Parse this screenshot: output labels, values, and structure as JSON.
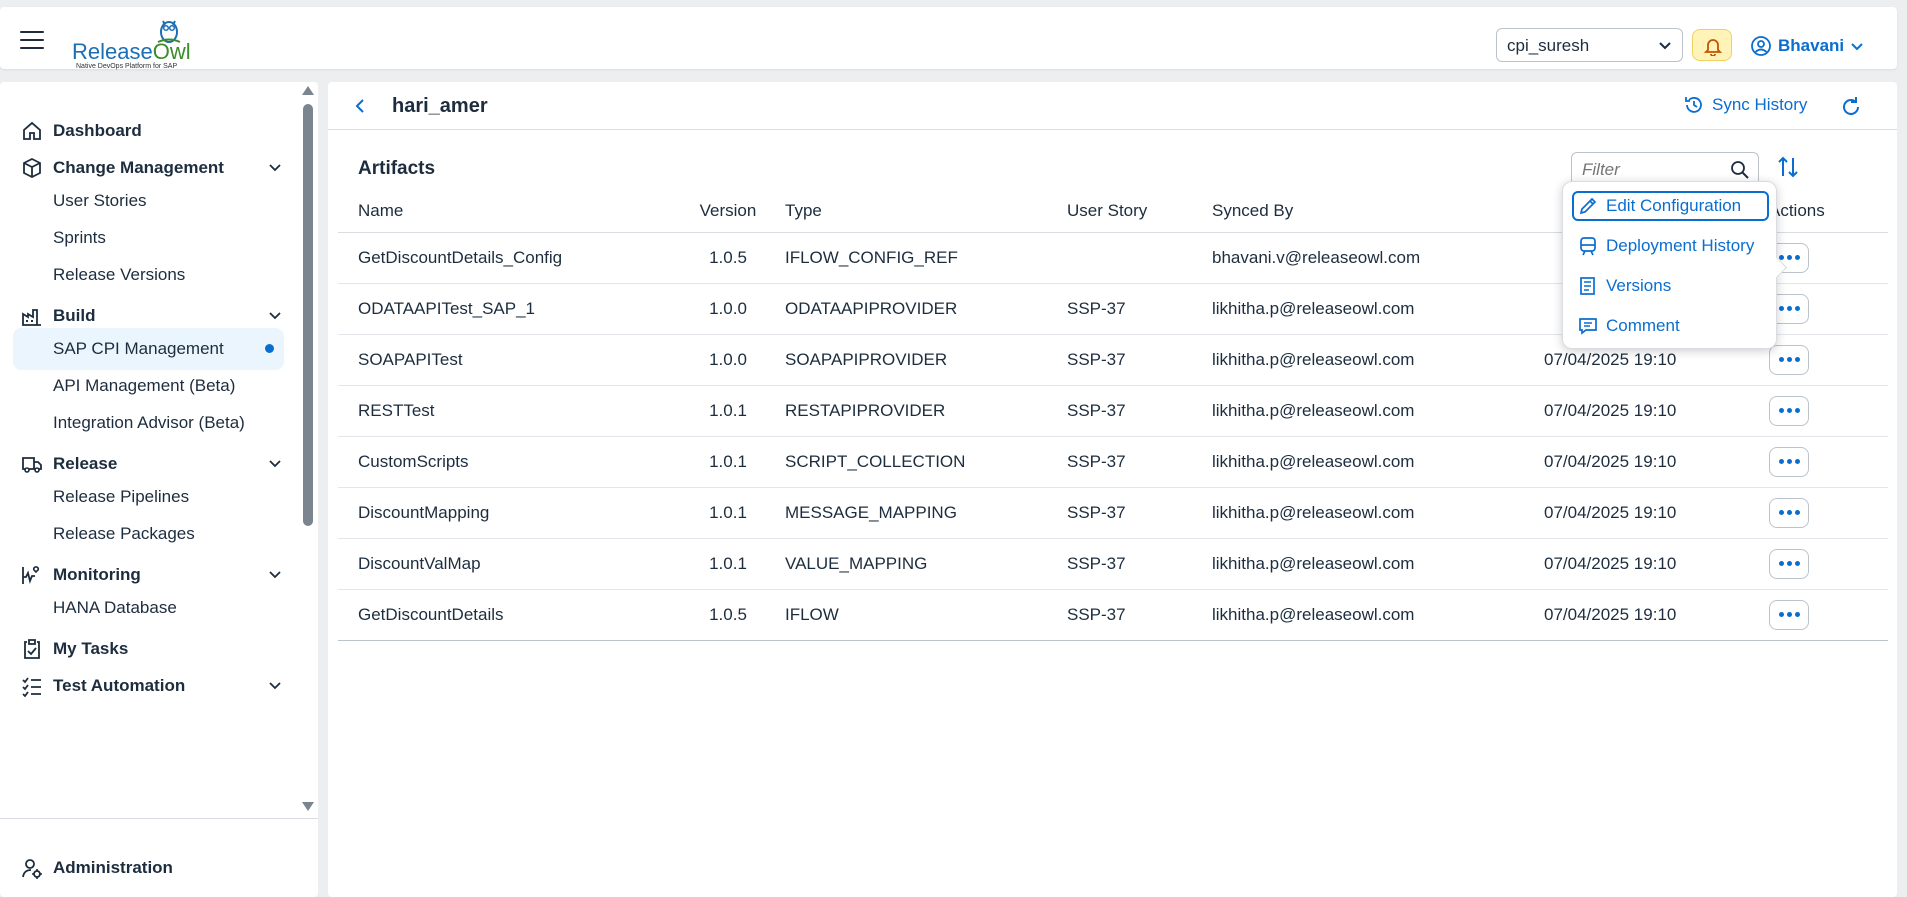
{
  "header": {
    "logo_release": "Release",
    "logo_owl": "Owl",
    "logo_tagline": "Native DevOps Platform for SAP",
    "tenant": "cpi_suresh",
    "user": "Bhavani"
  },
  "sidebar": {
    "groups": [
      {
        "label": "Dashboard",
        "icon": "home-icon"
      },
      {
        "label": "Change Management",
        "icon": "cube-icon"
      },
      {
        "label": "Build",
        "icon": "factory-icon"
      },
      {
        "label": "Release",
        "icon": "truck-icon"
      },
      {
        "label": "Monitoring",
        "icon": "heart-pulse-icon"
      },
      {
        "label": "My Tasks",
        "icon": "clipboard-icon"
      },
      {
        "label": "Test Automation",
        "icon": "checklist-icon"
      }
    ],
    "items": [
      "User Stories",
      "Sprints",
      "Release Versions",
      "SAP CPI Management",
      "API Management (Beta)",
      "Integration Advisor (Beta)",
      "Release Pipelines",
      "Release Packages",
      "HANA Database"
    ],
    "admin": "Administration"
  },
  "page": {
    "title": "hari_amer",
    "sync_history": "Sync History"
  },
  "artifacts": {
    "title": "Artifacts",
    "filter_placeholder": "Filter",
    "columns": [
      "Name",
      "Version",
      "Type",
      "User Story",
      "Synced By",
      "",
      "Actions"
    ],
    "rows": [
      {
        "name": "GetDiscountDetails_Config",
        "version": "1.0.5",
        "type": "IFLOW_CONFIG_REF",
        "story": "",
        "synced_by": "bhavani.v@releaseowl.com",
        "date": ""
      },
      {
        "name": "ODATAAPITest_SAP_1",
        "version": "1.0.0",
        "type": "ODATAAPIPROVIDER",
        "story": "SSP-37",
        "synced_by": "likhitha.p@releaseowl.com",
        "date": ""
      },
      {
        "name": "SOAPAPITest",
        "version": "1.0.0",
        "type": "SOAPAPIPROVIDER",
        "story": "SSP-37",
        "synced_by": "likhitha.p@releaseowl.com",
        "date": "07/04/2025 19:10"
      },
      {
        "name": "RESTTest",
        "version": "1.0.1",
        "type": "RESTAPIPROVIDER",
        "story": "SSP-37",
        "synced_by": "likhitha.p@releaseowl.com",
        "date": "07/04/2025 19:10"
      },
      {
        "name": "CustomScripts",
        "version": "1.0.1",
        "type": "SCRIPT_COLLECTION",
        "story": "SSP-37",
        "synced_by": "likhitha.p@releaseowl.com",
        "date": "07/04/2025 19:10"
      },
      {
        "name": "DiscountMapping",
        "version": "1.0.1",
        "type": "MESSAGE_MAPPING",
        "story": "SSP-37",
        "synced_by": "likhitha.p@releaseowl.com",
        "date": "07/04/2025 19:10"
      },
      {
        "name": "DiscountValMap",
        "version": "1.0.1",
        "type": "VALUE_MAPPING",
        "story": "SSP-37",
        "synced_by": "likhitha.p@releaseowl.com",
        "date": "07/04/2025 19:10"
      },
      {
        "name": "GetDiscountDetails",
        "version": "1.0.5",
        "type": "IFLOW",
        "story": "SSP-37",
        "synced_by": "likhitha.p@releaseowl.com",
        "date": "07/04/2025 19:10"
      }
    ]
  },
  "menu": {
    "items": [
      {
        "label": "Edit Configuration",
        "icon": "pencil-icon"
      },
      {
        "label": "Deployment History",
        "icon": "train-icon"
      },
      {
        "label": "Versions",
        "icon": "document-list-icon"
      },
      {
        "label": "Comment",
        "icon": "comment-icon"
      }
    ]
  },
  "colors": {
    "accent": "#0a6ed1",
    "selected_bg": "#ebf5fe",
    "bell_bg": "#fff3b8"
  }
}
